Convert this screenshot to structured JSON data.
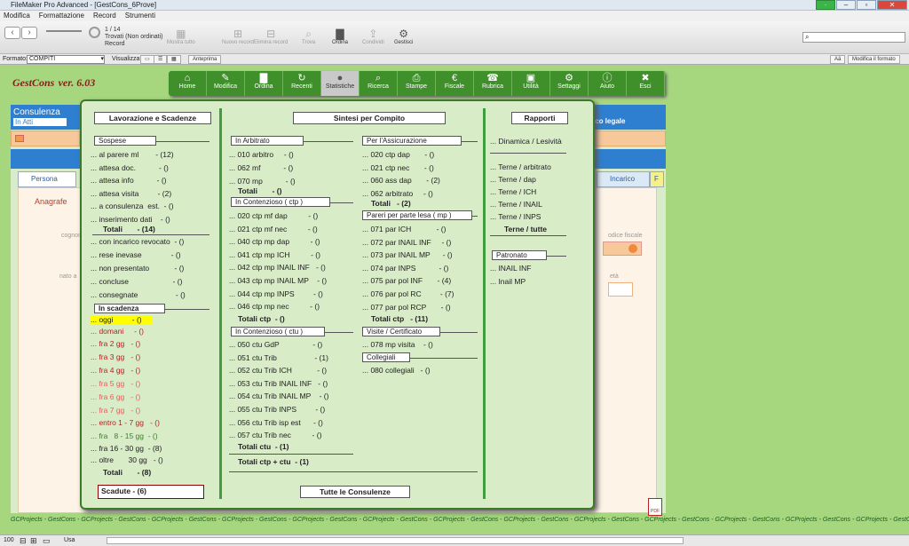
{
  "window": {
    "title": "FileMaker Pro Advanced - [GestCons_6Prove]"
  },
  "menu": [
    "Modifica",
    "Formattazione",
    "Record",
    "Strumenti"
  ],
  "toolbar": {
    "record_counter": "1 / 14",
    "found_status": "Trovati (Non ordinati)",
    "record_label": "Record",
    "buttons": [
      "Mostra tutto",
      "Nuovo record",
      "Elimina record",
      "Trova",
      "Ordina",
      "Condividi",
      "Gestisci"
    ]
  },
  "formatbar": {
    "format_label": "Formato:",
    "format_value": "COMPITI",
    "view_label": "Visualizza:",
    "preview": "Anteprima",
    "aa": "Aä",
    "edit_format": "Modifica il formato"
  },
  "app": {
    "name": "GestCons",
    "version": "ver. 6.03"
  },
  "nav": [
    {
      "label": "Home",
      "icon": "⌂"
    },
    {
      "label": "Modifica",
      "icon": "✎"
    },
    {
      "label": "Ordina",
      "icon": "▇"
    },
    {
      "label": "Recenti",
      "icon": "↻"
    },
    {
      "label": "Statistiche",
      "icon": "●"
    },
    {
      "label": "Ricerca",
      "icon": "⌕"
    },
    {
      "label": "Stampe",
      "icon": "⎙"
    },
    {
      "label": "Fiscale",
      "icon": "€"
    },
    {
      "label": "Rubrica",
      "icon": "☎"
    },
    {
      "label": "Utilità",
      "icon": "▣"
    },
    {
      "label": "Settaggi",
      "icon": "⚙"
    },
    {
      "label": "Aiuto",
      "icon": "ⓘ"
    },
    {
      "label": "Esci",
      "icon": "✖"
    }
  ],
  "background": {
    "consulenza": "Consulenza",
    "in_atti": "In Atti",
    "legal_label": "ico legale",
    "tab_persona": "Persona",
    "tab_incarico": "Incarico",
    "tab_f": "F",
    "anagrafe": "Anagrafe",
    "cognome": "cognom",
    "nato": "nato a",
    "eta": "età",
    "codice": "odice fiscale"
  },
  "popup": {
    "col1": {
      "header": "Lavorazione e Scadenze",
      "sospese": "Sospese",
      "rows1": [
        "... al parere ml        - (12)",
        "... attesa doc.           - ()",
        "... attesa info           - ()",
        "... attesa visita         - (2)",
        "... a consulenza  est.  - ()",
        "... inserimento dati    - ()"
      ],
      "totali1": "Totali       - (14)",
      "rows2": [
        "... con incarico revocato  - ()",
        "... rese inevase              - ()",
        "... non presentato            - ()",
        "... concluse                     - ()",
        "... consegnate                  - ()"
      ],
      "scadenza": "In scadenza",
      "oggi": "... oggi         - ()",
      "domani": "... domani     - ()",
      "fra": [
        "... fra 2 gg   - ()",
        "... fra 3 gg   - ()",
        "... fra 4 gg   - ()"
      ],
      "fra_pink": [
        "... fra 5 gg   - ()",
        "... fra 6 gg   - ()",
        "... fra 7 gg   - ()"
      ],
      "entro": "... entro 1 - 7 gg   - ()",
      "fra_grn": [
        "... fra   8 - 15 gg  - ()",
        "... fra 16 - 30 gg  - (8)"
      ],
      "oltre": "... oltre       30 gg   - ()",
      "totali2": "Totali       - (8)",
      "scadute": "Scadute    - (6)"
    },
    "col2": {
      "header": "Sintesi per Compito",
      "arbitrato": "In Arbitrato",
      "arb_rows": [
        "... 010 arbitro     - ()",
        "... 062 mf           - ()",
        "... 070 mp           - ()"
      ],
      "arb_tot": "Totali       - ()",
      "ctp": "In Contenzioso ( ctp )",
      "ctp_rows": [
        "... 020 ctp mf dap          - ()",
        "... 021 ctp mf nec          - ()",
        "... 040 ctp mp dap          - ()",
        "... 041 ctp mp ICH          - ()",
        "... 042 ctp mp INAIL INF   - ()",
        "... 043 ctp mp INAIL MP    - ()",
        "... 044 ctp mp INPS         - ()",
        "... 046 ctp mp nec          - ()"
      ],
      "ctp_tot": "Totali ctp  - ()",
      "ctu": "In Contenzioso ( ctu )",
      "ctu_rows": [
        "... 050 ctu GdP                - ()",
        "... 051 ctu Trib                  - (1)",
        "... 052 ctu Trib ICH            - ()",
        "... 053 ctu Trib INAIL INF   - ()",
        "... 054 ctu Trib INAIL MP    - ()",
        "... 055 ctu Trib INPS         - ()",
        "... 056 ctu Trib isp est      - ()",
        "... 057 ctu Trib nec          - ()"
      ],
      "ctu_tot": "Totali ctu  - (1)",
      "ctp_ctu_tot": "Totali ctp + ctu  - (1)",
      "assic": "Per l'Assicurazione",
      "assic_rows": [
        "... 020 ctp dap       - ()",
        "... 021 ctp nec       - ()",
        "... 060 ass dap       - (2)",
        "... 062 arbitrato     - ()"
      ],
      "assic_tot": "Totali   - (2)",
      "pareri": "Pareri per parte lesa ( mp )",
      "pareri_rows": [
        "... 071 par ICH            - ()",
        "... 072 par INAIL INF     - ()",
        "... 073 par INAIL MP      - ()",
        "... 074 par INPS           - ()",
        "... 075 par pol INF       - (4)",
        "... 076 par pol RC         - (7)",
        "... 077 par pol RCP       - ()"
      ],
      "pareri_tot": "Totali ctp   - (11)",
      "visite": "Visite / Certificato",
      "visite_rows": [
        "... 078 mp visita    - ()"
      ],
      "collegiali": "Collegiali",
      "coll_rows": [
        "... 080 collegiali   - ()"
      ],
      "tutte": "Tutte le Consulenze"
    },
    "col3": {
      "header": "Rapporti",
      "rows1": [
        "... Dinamica / Lesività"
      ],
      "rows2": [
        "... Terne / arbitrato",
        "... Terne / dap",
        "... Terne / ICH",
        "... Terne / INAIL",
        "... Terne / INPS"
      ],
      "terne_tutte": "Terne / tutte",
      "patronato": "Patronato",
      "pat_rows": [
        "... INAIL INF",
        "... Inail MP"
      ]
    }
  },
  "footer": "GCProjects - GestCons - GCProjects - GestCons - GCProjects - GestCons - GCProjects - GestCons - GCProjects - GestCons - GCProjects - GestCons - GCProjects - GestCons - GCProjects - GestCons - GCProjects - GestCons - GCProjects - GestCons - GCProjects - GestCons - GCProjects - GestCons - GCProjects - GestCons - GCProjects - GestCons",
  "status": {
    "zoom": "100",
    "mode": "Usa"
  },
  "pdf": "PDF"
}
